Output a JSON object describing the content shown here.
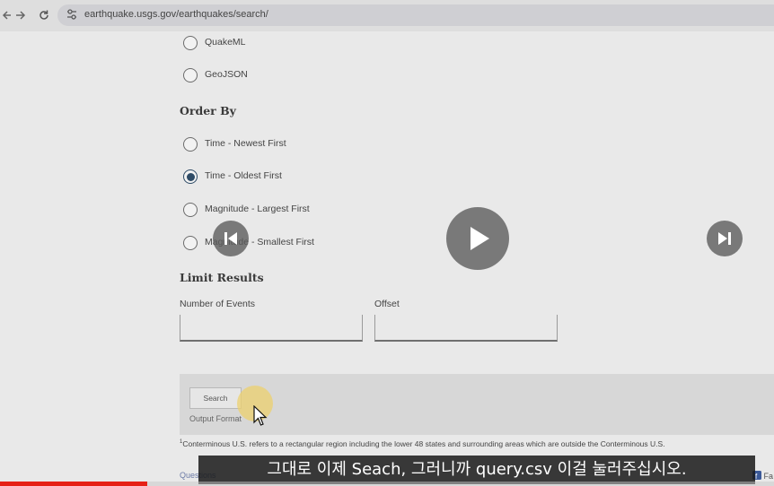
{
  "browser": {
    "url": "earthquake.usgs.gov/earthquakes/search/",
    "back_icon": "arrow-left-icon",
    "forward_icon": "arrow-right-icon",
    "reload_icon": "reload-icon",
    "site_settings_icon": "tune-icon"
  },
  "format_options": [
    {
      "label": "QuakeML",
      "checked": false
    },
    {
      "label": "GeoJSON",
      "checked": false
    }
  ],
  "order_by": {
    "title": "Order By",
    "options": [
      {
        "label": "Time - Newest First",
        "checked": false
      },
      {
        "label": "Time - Oldest First",
        "checked": true
      },
      {
        "label": "Magnitude - Largest First",
        "checked": false
      },
      {
        "label": "Magnitude - Smallest First",
        "checked": false
      }
    ]
  },
  "limit_results": {
    "title": "Limit Results",
    "number_of_events_label": "Number of Events",
    "number_of_events_value": "",
    "offset_label": "Offset",
    "offset_value": ""
  },
  "search_panel": {
    "search_label": "Search",
    "output_format_label": "Output Format"
  },
  "footnote": {
    "marker": "1",
    "text": "Conterminous U.S. refers to a rectangular region including the lower 48 states and surrounding areas which are outside the Conterminous U.S."
  },
  "footer": {
    "questions_label": "Questions",
    "fb_label": "Fa"
  },
  "video": {
    "subtitle": "그대로 이제 Seach, 그러니까 query.csv 이걸 눌러주십시오.",
    "progress": 0.19,
    "colors": {
      "progress": "#e62117",
      "selected_radio": "#2e4b66"
    }
  }
}
